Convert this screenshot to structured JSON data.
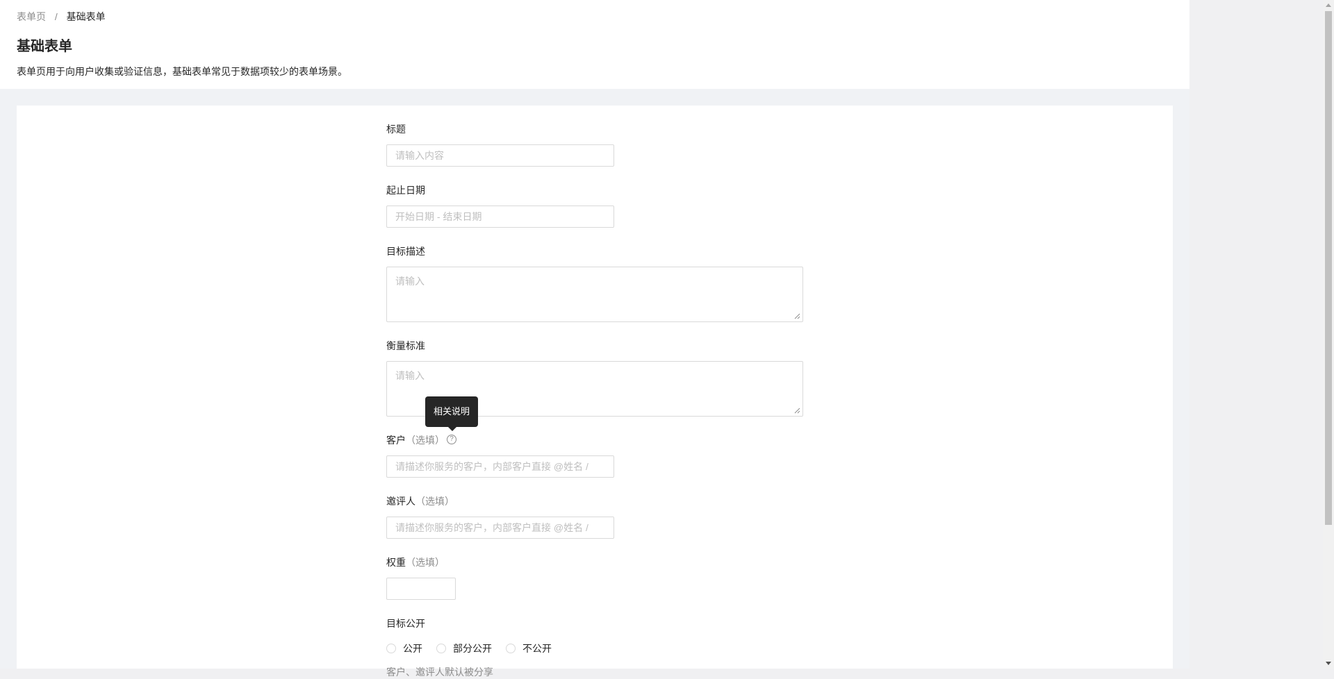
{
  "breadcrumb": {
    "parent": "表单页",
    "separator": "/",
    "current": "基础表单"
  },
  "page": {
    "title": "基础表单",
    "description": "表单页用于向用户收集或验证信息，基础表单常见于数据项较少的表单场景。"
  },
  "form": {
    "title": {
      "label": "标题",
      "placeholder": "请输入内容"
    },
    "date_range": {
      "label": "起止日期",
      "placeholder": "开始日期 - 结束日期"
    },
    "goal": {
      "label": "目标描述",
      "placeholder": "请输入"
    },
    "standard": {
      "label": "衡量标准",
      "placeholder": "请输入"
    },
    "client": {
      "label": "客户",
      "optional": "（选填）",
      "help_icon": "question-circle-icon",
      "tooltip": "相关说明",
      "placeholder": "请描述你服务的客户，内部客户直接 @姓名 / "
    },
    "invites": {
      "label": "邀评人",
      "optional": "（选填）",
      "placeholder": "请描述你服务的客户，内部客户直接 @姓名 / "
    },
    "weight": {
      "label": "权重",
      "optional": "（选填）",
      "value": ""
    },
    "public": {
      "label": "目标公开",
      "options": [
        "公开",
        "部分公开",
        "不公开"
      ],
      "hint": "客户、邀评人默认被分享"
    }
  },
  "colors": {
    "page_bg": "#f0f2f5",
    "card_bg": "#ffffff",
    "border": "#d9d9d9",
    "placeholder": "#bfbfbf",
    "tooltip_bg": "#262626"
  }
}
